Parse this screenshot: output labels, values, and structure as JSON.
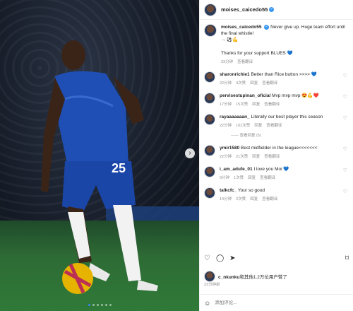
{
  "header": {
    "username": "moises_caicedo55"
  },
  "caption": {
    "username": "moises_caicedo55",
    "line1": "Never give up. Huge team effort until the final whistle!",
    "line2": "→ ⚽💪",
    "line3": "Thanks for your support BLUES 💙",
    "time": "23分钟",
    "translate": "查看翻译"
  },
  "comments": [
    {
      "username": "sharonrichie1",
      "text": "Better than Rice button >>>> 💙",
      "time": "22分钟",
      "likes": "4次赞",
      "reply": "回复",
      "translate": "查看翻译"
    },
    {
      "username": "pervisestupinan_oficial",
      "text": "Mvp mvp mvp 😍💪❤️",
      "time": "17分钟",
      "likes": "15次赞",
      "reply": "回复",
      "translate": "查看翻译"
    },
    {
      "username": "rayaaaaaaan_",
      "text": "Literally our best player this season",
      "time": "22分钟",
      "likes": "102次赞",
      "reply": "回复",
      "translate": "查看翻译",
      "view_replies": "—— 查看回复 (5)"
    },
    {
      "username": "ymir1580",
      "text": "Best midfielder in the league<<<<<<<",
      "time": "22分钟",
      "likes": "21次赞",
      "reply": "回复",
      "translate": "查看翻译"
    },
    {
      "username": "i_am_adufe_01",
      "text": "I love you Moi 💙",
      "time": "9分钟",
      "likes": "1次赞",
      "reply": "回复",
      "translate": "查看翻译"
    },
    {
      "username": "talkcfc_",
      "text": "Your so good",
      "time": "14分钟",
      "likes": "2次赞",
      "reply": "回复",
      "translate": "查看翻译"
    }
  ],
  "likes": {
    "user": "c_nkunku",
    "text": "和其他1.2万位用户赞了"
  },
  "post_time": "23分钟前",
  "add_comment": {
    "placeholder": "添加评论..."
  },
  "icons": {
    "like": "heart-icon",
    "comment": "comment-icon",
    "share": "share-icon",
    "save": "bookmark-icon"
  }
}
